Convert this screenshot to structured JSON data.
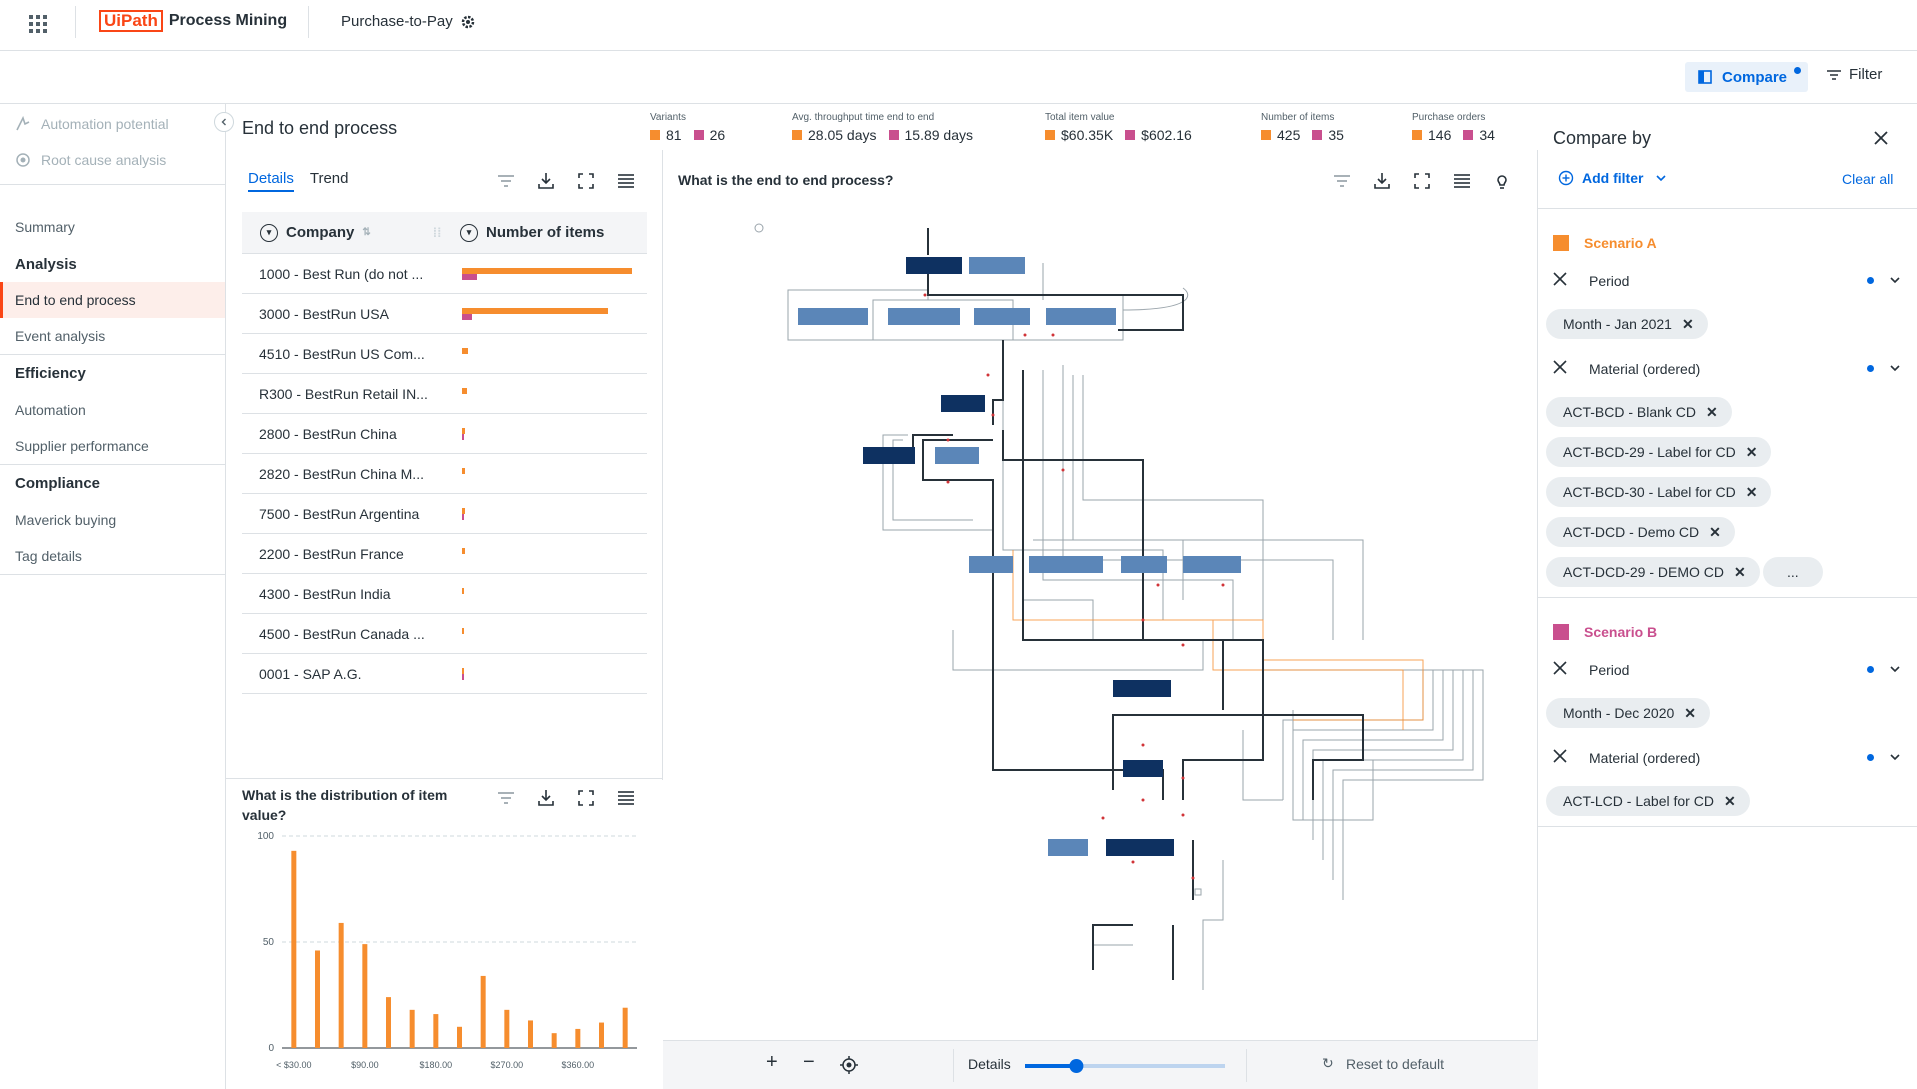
{
  "header": {
    "logo_mark": "UiPath",
    "product": "Process Mining",
    "process_name": "Purchase-to-Pay"
  },
  "toolbar": {
    "compare_label": "Compare",
    "filter_label": "Filter"
  },
  "sidebar": {
    "items": [
      {
        "label": "Automation potential"
      },
      {
        "label": "Root cause analysis"
      },
      {
        "label": "Summary"
      },
      {
        "label": "Analysis"
      },
      {
        "label": "End to end process"
      },
      {
        "label": "Event analysis"
      },
      {
        "label": "Efficiency"
      },
      {
        "label": "Automation"
      },
      {
        "label": "Supplier performance"
      },
      {
        "label": "Compliance"
      },
      {
        "label": "Maverick buying"
      },
      {
        "label": "Tag details"
      }
    ]
  },
  "main": {
    "title": "End to end process",
    "kpis": [
      {
        "label": "Variants",
        "a": "81",
        "b": "26"
      },
      {
        "label": "Avg. throughput time end to end",
        "a": "28.05 days",
        "b": "15.89 days"
      },
      {
        "label": "Total item value",
        "a": "$60.35K",
        "b": "$602.16"
      },
      {
        "label": "Number of items",
        "a": "425",
        "b": "35"
      },
      {
        "label": "Purchase orders",
        "a": "146",
        "b": "34"
      }
    ],
    "tabs": [
      "Details",
      "Trend"
    ],
    "table": {
      "col1": "Company",
      "col2": "Number of items",
      "rows": [
        {
          "name": "1000 - Best Run (do not ...",
          "a": 1.0,
          "b": 0.09
        },
        {
          "name": "3000 - BestRun USA",
          "a": 0.86,
          "b": 0.06
        },
        {
          "name": "4510 - BestRun US Com...",
          "a": 0.035,
          "b": 0
        },
        {
          "name": "R300 - BestRun Retail IN...",
          "a": 0.03,
          "b": 0
        },
        {
          "name": "2800 - BestRun China",
          "a": 0.02,
          "b": 0.01
        },
        {
          "name": "2820 - BestRun China M...",
          "a": 0.02,
          "b": 0
        },
        {
          "name": "7500 - BestRun Argentina",
          "a": 0.015,
          "b": 0.01
        },
        {
          "name": "2200 - BestRun France",
          "a": 0.02,
          "b": 0
        },
        {
          "name": "4300 - BestRun India",
          "a": 0.01,
          "b": 0
        },
        {
          "name": "4500 - BestRun Canada ...",
          "a": 0.01,
          "b": 0
        },
        {
          "name": "0001 - SAP A.G.",
          "a": 0.005,
          "b": 0.005
        }
      ]
    },
    "distribution": {
      "title": "What is the distribution of item value?"
    },
    "process_graph": {
      "title": "What is the end to end process?"
    },
    "zoom": {
      "details_label": "Details",
      "details_level": 0.23,
      "reset_label": "Reset to default"
    }
  },
  "chart_data": {
    "type": "bar",
    "title": "What is the distribution of item value?",
    "xlabel": "",
    "ylabel": "",
    "ylim": [
      0,
      100
    ],
    "yticks": [
      "0",
      "50",
      "100"
    ],
    "xticks": [
      "< $30.00",
      "$90.00",
      "$180.00",
      "$270.00",
      "$360.00"
    ],
    "values": [
      93,
      46,
      59,
      49,
      24,
      18,
      16,
      10,
      34,
      18,
      13,
      7,
      9,
      12,
      19
    ]
  },
  "compare": {
    "title": "Compare by",
    "add_filter": "Add filter",
    "clear_all": "Clear all",
    "scenario_a": {
      "name": "Scenario A",
      "period_label": "Period",
      "period_value": "Month - Jan 2021",
      "material_label": "Material (ordered)",
      "materials": [
        "ACT-BCD - Blank CD",
        "ACT-BCD-29 - Label for CD",
        "ACT-BCD-30 - Label for CD",
        "ACT-DCD - Demo CD",
        "ACT-DCD-29 - DEMO CD"
      ],
      "more": "..."
    },
    "scenario_b": {
      "name": "Scenario B",
      "period_label": "Period",
      "period_value": "Month - Dec 2020",
      "material_label": "Material (ordered)",
      "materials": [
        "ACT-LCD - Label for CD"
      ]
    }
  },
  "colors": {
    "scenario_a": "#f68d2e",
    "scenario_b": "#c94f8e",
    "accent": "#0067df",
    "brand": "#fa4616"
  }
}
